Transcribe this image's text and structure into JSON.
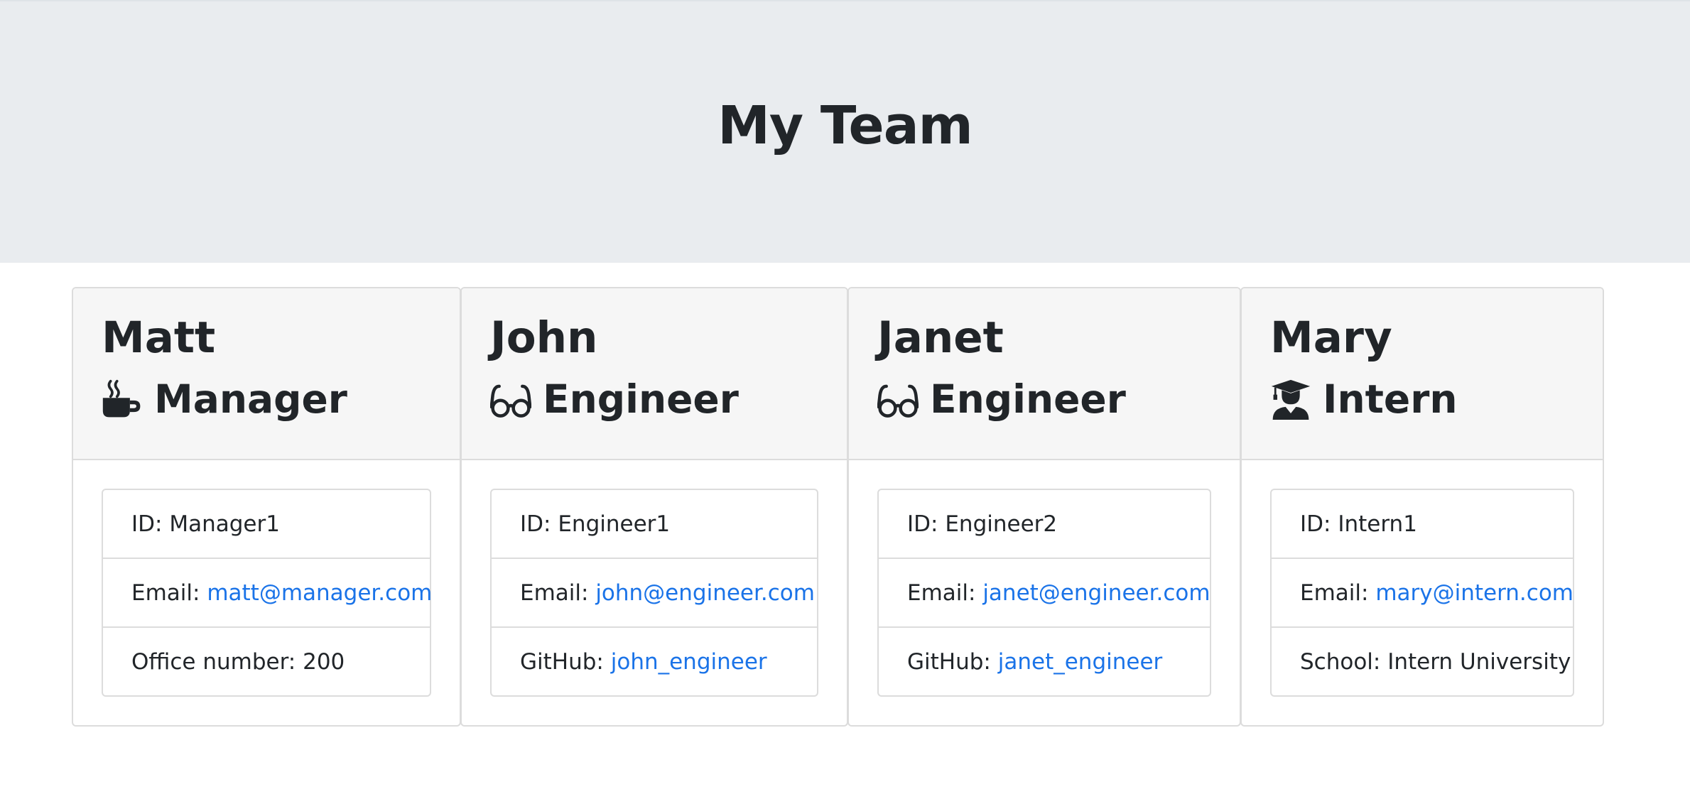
{
  "header": {
    "title": "My Team"
  },
  "cards": [
    {
      "name": "Matt",
      "role": "Manager",
      "icon": "coffee-icon",
      "id_label": "ID: ",
      "id": "Manager1",
      "email_label": "Email: ",
      "email": "matt@manager.com",
      "extra_label": "Office number: ",
      "extra": "200"
    },
    {
      "name": "John",
      "role": "Engineer",
      "icon": "glasses-icon",
      "id_label": "ID: ",
      "id": "Engineer1",
      "email_label": "Email: ",
      "email": "john@engineer.com",
      "extra_label": "GitHub: ",
      "extra": "john_engineer"
    },
    {
      "name": "Janet",
      "role": "Engineer",
      "icon": "glasses-icon",
      "id_label": "ID: ",
      "id": "Engineer2",
      "email_label": "Email: ",
      "email": "janet@engineer.com",
      "extra_label": "GitHub: ",
      "extra": "janet_engineer"
    },
    {
      "name": "Mary",
      "role": "Intern",
      "icon": "graduate-icon",
      "id_label": "ID: ",
      "id": "Intern1",
      "email_label": "Email: ",
      "email": "mary@intern.com",
      "extra_label": "School: ",
      "extra": "Intern University"
    }
  ],
  "colors": {
    "header_bg": "#e9ecef",
    "card_header_bg": "#f6f6f6",
    "link": "#1a73e8",
    "text": "#212529"
  }
}
